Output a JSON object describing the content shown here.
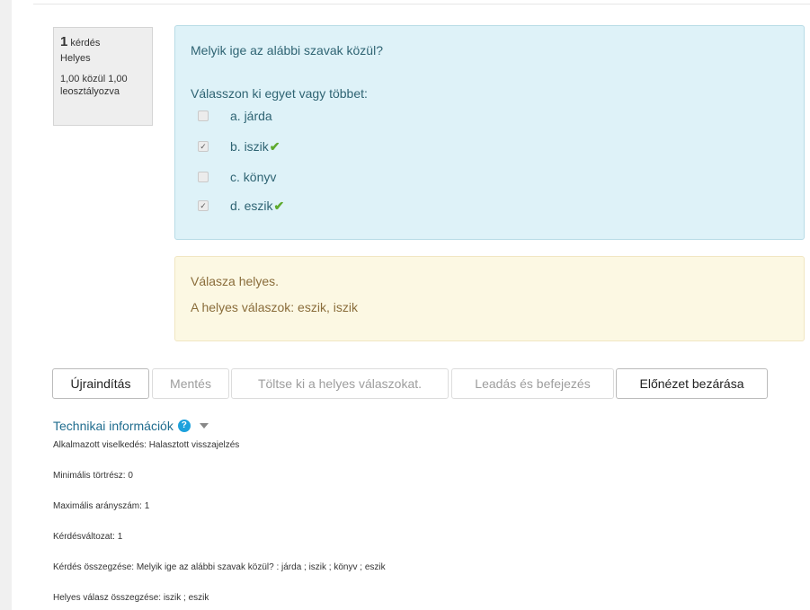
{
  "question_info": {
    "number": "1",
    "number_label": "kérdés",
    "state": "Helyes",
    "grade_line1": "1,00 közül 1,00",
    "grade_line2": "leosztályozva"
  },
  "question": {
    "text": "Melyik ige az alábbi szavak közül?",
    "prompt": "Válasszon ki egyet vagy többet:",
    "answers": [
      {
        "label": "a. járda",
        "checked": false,
        "correct": false
      },
      {
        "label": "b. iszik",
        "checked": true,
        "correct": true
      },
      {
        "label": "c. könyv",
        "checked": false,
        "correct": false
      },
      {
        "label": "d. eszik",
        "checked": true,
        "correct": true
      }
    ]
  },
  "feedback": {
    "line1": "Válasza helyes.",
    "line2": "A helyes válaszok: eszik, iszik"
  },
  "buttons": {
    "restart": "Újraindítás",
    "save": "Mentés",
    "fill_correct": "Töltse ki a helyes válaszokat.",
    "submit_finish": "Leadás és befejezés",
    "close_preview": "Előnézet bezárása"
  },
  "technical": {
    "title": "Technikai információk",
    "help_glyph": "?",
    "lines": [
      "Alkalmazott viselkedés: Halasztott visszajelzés",
      "Minimális törtrész: 0",
      "Maximális arányszám: 1",
      "Kérdésváltozat: 1",
      "Kérdés összegzése: Melyik ige az alábbi szavak közül? : járda ; iszik ; könyv ; eszik",
      "Helyes válasz összegzése: iszik ; eszik"
    ]
  },
  "colors": {
    "formulation_bg": "#def2f8",
    "feedback_bg": "#fcf8e3",
    "correct_tick": "#5eaa2e",
    "link_blue": "#1f6c8e"
  }
}
